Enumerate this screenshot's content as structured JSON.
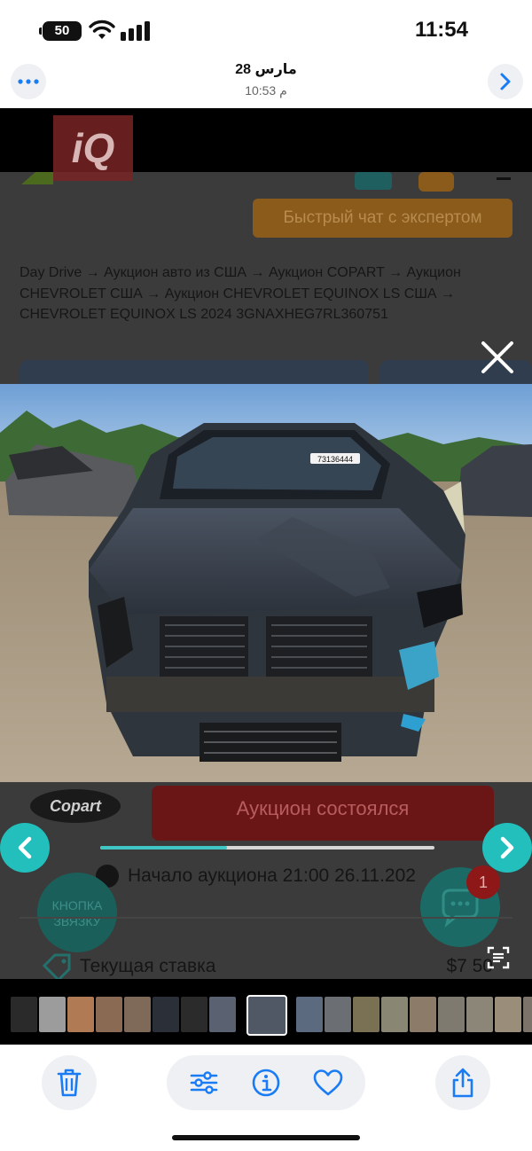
{
  "status": {
    "battery": "50",
    "time": "11:54"
  },
  "nav": {
    "date": "28 مارس",
    "time": "10:53 م"
  },
  "page": {
    "logo_text": "iQ",
    "chat_button": "Быстрый чат с экспертом",
    "breadcrumbs": "Day Drive → Аукцион авто из США → Аукцион COPART → Аукцион CHEVROLET США → Аукцион CHEVROLET EQUINOX LS США → CHEVROLET EQUINOX LS 2024 3GNAXHEG7RL360751",
    "copart_logo": "Copart",
    "auction_status": "Аукцион состоялся",
    "auction_start": "Начало аукциона 21:00 26.11.202",
    "call_button": "КНОПКА ЗВЯЗКУ",
    "chat_badge": "1",
    "current_bid_label": "Текущая ставка",
    "current_bid_value": "$7 50"
  },
  "photo": {
    "plate_label": "73136444"
  },
  "viewer": {
    "progress": 0.38,
    "thumbnail_count": 20,
    "active_thumbnail": 8
  },
  "colors": {
    "accent": "#23bfbd",
    "toolbar_icon": "#1a7cf5"
  },
  "icons": {
    "more": "ellipsis-icon",
    "next": "chevron-right-icon",
    "close": "close-icon",
    "prev_photo": "arrow-left-icon",
    "next_photo": "arrow-right-icon",
    "delete": "trash-icon",
    "adjust": "sliders-icon",
    "info": "info-icon",
    "favorite": "heart-icon",
    "share": "share-icon"
  }
}
